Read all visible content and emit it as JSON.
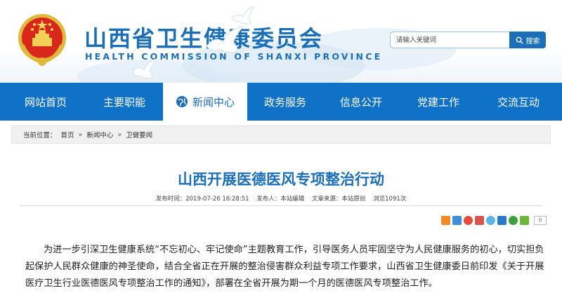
{
  "header": {
    "title_cn": "山西省卫生健康委员会",
    "title_en": "HEALTH COMMISSION OF SHANXI PROVINCE",
    "search": {
      "placeholder": "请输入关键词",
      "button_label": "搜索"
    }
  },
  "nav": {
    "items": [
      {
        "label": "网站首页",
        "active": false
      },
      {
        "label": "主要职能",
        "active": false
      },
      {
        "label": "新闻中心",
        "active": true
      },
      {
        "label": "政务服务",
        "active": false
      },
      {
        "label": "信息公开",
        "active": false
      },
      {
        "label": "党建工作",
        "active": false
      },
      {
        "label": "交流互动",
        "active": false
      }
    ]
  },
  "breadcrumb": {
    "prefix": "当前位置：",
    "items": [
      "首页",
      "新闻中心",
      "卫健要闻"
    ],
    "separator": "»"
  },
  "article": {
    "title": "山西开展医德医风专项整治行动",
    "meta": {
      "published": "发布时间：2019-07-26 16:28:51",
      "publisher": "发布人：本站编辑",
      "source": "文章来源：本站原创",
      "views": "浏览1091次"
    },
    "share_count": "0",
    "paragraph": "为进一步引深卫生健康系统“不忘初心、牢记使命”主题教育工作，引导医务人员牢固坚守为人民健康服务的初心，切实担负起保护人民群众健康的神圣使命，结合全省正在开展的整治侵害群众利益专项工作要求，山西省卫生健康委日前印发《关于开展医疗卫生行业医德医风专项整治工作的通知》，部署在全省开展为期一个月的医德医风专项整治工作。"
  },
  "colors": {
    "brand_blue": "#1b6fb8",
    "nav_blue": "#0f72c7",
    "breadcrumb_bg": "#f1f1f1"
  },
  "icons": [
    "national-emblem-icon",
    "dove-icon",
    "search-icon",
    "globe-icon",
    "share-icons"
  ]
}
